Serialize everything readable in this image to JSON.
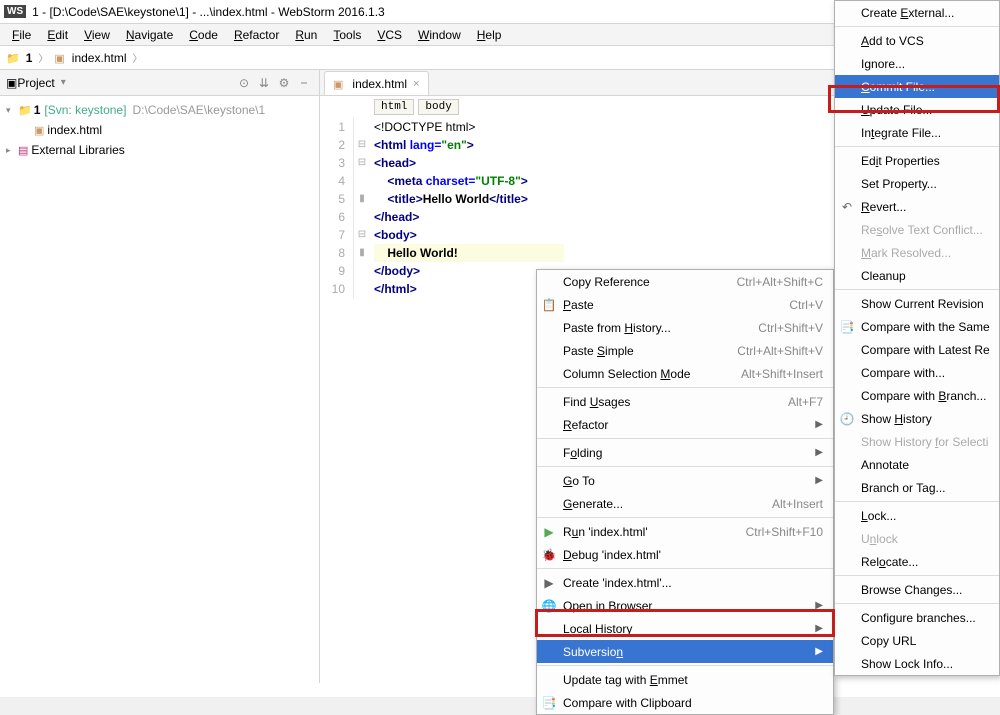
{
  "title": "1 - [D:\\Code\\SAE\\keystone\\1] - ...\\index.html - WebStorm 2016.1.3",
  "menubar": [
    "File",
    "Edit",
    "View",
    "Navigate",
    "Code",
    "Refactor",
    "Run",
    "Tools",
    "VCS",
    "Window",
    "Help"
  ],
  "nav": {
    "root": "1",
    "file": "index.html"
  },
  "sidebar": {
    "header": "Project",
    "root": "1",
    "vcs": "[Svn: keystone]",
    "path": "D:\\Code\\SAE\\keystone\\1",
    "file": "index.html",
    "ext": "External Libraries"
  },
  "editor": {
    "tab": "index.html",
    "crumbs": [
      "html",
      "body"
    ],
    "lines": [
      {
        "n": 1,
        "html": "&lt;!DOCTYPE html&gt;",
        "cls": "tok-tag"
      },
      {
        "n": 2,
        "html": "<span class='tok-ang'>&lt;</span><span class='tok-tag'>html</span> <span class='tok-attr'>lang=</span><span class='tok-str'>\"en\"</span><span class='tok-ang'>&gt;</span>"
      },
      {
        "n": 3,
        "html": "<span class='tok-ang'>&lt;</span><span class='tok-tag'>head</span><span class='tok-ang'>&gt;</span>"
      },
      {
        "n": 4,
        "html": "&nbsp;&nbsp;&nbsp;&nbsp;<span class='tok-ang'>&lt;</span><span class='tok-tag'>meta</span> <span class='tok-attr'>charset=</span><span class='tok-str'>\"UTF-8\"</span><span class='tok-ang'>&gt;</span>"
      },
      {
        "n": 5,
        "html": "&nbsp;&nbsp;&nbsp;&nbsp;<span class='tok-ang'>&lt;</span><span class='tok-tag'>title</span><span class='tok-ang'>&gt;</span><span class='tok-text'>Hello World</span><span class='tok-ang'>&lt;/</span><span class='tok-tag'>title</span><span class='tok-ang'>&gt;</span>"
      },
      {
        "n": 6,
        "html": "<span class='tok-ang'>&lt;/</span><span class='tok-tag'>head</span><span class='tok-ang'>&gt;</span>"
      },
      {
        "n": 7,
        "html": "<span class='tok-ang'>&lt;</span><span class='tok-tag'>body</span><span class='tok-ang'>&gt;</span>"
      },
      {
        "n": 8,
        "html": "<span class='hl'>&nbsp;&nbsp;&nbsp;&nbsp;<span class='tok-text'>Hello World!</span></span>"
      },
      {
        "n": 9,
        "html": "<span class='tok-ang'>&lt;/</span><span class='tok-tag'>body</span><span class='tok-ang'>&gt;</span>"
      },
      {
        "n": 10,
        "html": "<span class='tok-ang'>&lt;/</span><span class='tok-tag'>html</span><span class='tok-ang'>&gt;</span>"
      }
    ],
    "marks": {
      "2": "⊟",
      "3": "⊟",
      "5": "▮",
      "7": "⊟",
      "8": "▮"
    }
  },
  "ctx1": [
    {
      "t": "item",
      "label": "Copy Reference",
      "sc": "Ctrl+Alt+Shift+C"
    },
    {
      "t": "item",
      "label": "<u>P</u>aste",
      "sc": "Ctrl+V",
      "ic": "📋"
    },
    {
      "t": "item",
      "label": "Paste from <u>H</u>istory...",
      "sc": "Ctrl+Shift+V"
    },
    {
      "t": "item",
      "label": "Paste <u>S</u>imple",
      "sc": "Ctrl+Alt+Shift+V"
    },
    {
      "t": "item",
      "label": "Column Selection <u>M</u>ode",
      "sc": "Alt+Shift+Insert"
    },
    {
      "t": "sep"
    },
    {
      "t": "item",
      "label": "Find <u>U</u>sages",
      "sc": "Alt+F7"
    },
    {
      "t": "item",
      "label": "<u>R</u>efactor",
      "sub": true
    },
    {
      "t": "sep"
    },
    {
      "t": "item",
      "label": "F<u>o</u>lding",
      "sub": true
    },
    {
      "t": "sep"
    },
    {
      "t": "item",
      "label": "<u>G</u>o To",
      "sub": true
    },
    {
      "t": "item",
      "label": "<u>G</u>enerate...",
      "sc": "Alt+Insert"
    },
    {
      "t": "sep"
    },
    {
      "t": "item",
      "label": "R<u>u</u>n 'index.html'",
      "sc": "Ctrl+Shift+F10",
      "ic": "▶",
      "icc": "#5a5"
    },
    {
      "t": "item",
      "label": "<u>D</u>ebug 'index.html'",
      "ic": "🐞"
    },
    {
      "t": "sep"
    },
    {
      "t": "item",
      "label": "Create 'index.html'...",
      "ic": "▶"
    },
    {
      "t": "item",
      "label": "<u>O</u>pen in Browser",
      "sub": true,
      "ic": "🌐"
    },
    {
      "t": "item",
      "label": "<u>L</u>ocal History",
      "sub": true
    },
    {
      "t": "item",
      "label": "Subversio<u>n</u>",
      "sub": true,
      "sel": true
    },
    {
      "t": "sep"
    },
    {
      "t": "item",
      "label": "Update tag with <u>E</u>mmet"
    },
    {
      "t": "item",
      "label": "Compare with Clipboard",
      "ic": "📑"
    }
  ],
  "ctx2": [
    {
      "t": "item",
      "label": "Create <u>E</u>xternal..."
    },
    {
      "t": "sep"
    },
    {
      "t": "item",
      "label": "<u>A</u>dd to VCS"
    },
    {
      "t": "item",
      "label": "I<u>g</u>nore..."
    },
    {
      "t": "item",
      "label": "<u>C</u>ommit File...",
      "sel": true
    },
    {
      "t": "item",
      "label": "<u>U</u>pdate File..."
    },
    {
      "t": "item",
      "label": "In<u>t</u>egrate File..."
    },
    {
      "t": "sep"
    },
    {
      "t": "item",
      "label": "Ed<u>i</u>t Properties"
    },
    {
      "t": "item",
      "label": "Set Property..."
    },
    {
      "t": "item",
      "label": "<u>R</u>evert...",
      "ic": "↶"
    },
    {
      "t": "item",
      "label": "Re<u>s</u>olve Text Conflict...",
      "dis": true
    },
    {
      "t": "item",
      "label": "<u>M</u>ark Resolved...",
      "dis": true
    },
    {
      "t": "item",
      "label": "Cleanup"
    },
    {
      "t": "sep"
    },
    {
      "t": "item",
      "label": "Show Current Revision"
    },
    {
      "t": "item",
      "label": "Compare with the Same",
      "ic": "📑"
    },
    {
      "t": "item",
      "label": "Compare with Latest Re"
    },
    {
      "t": "item",
      "label": "Compare with..."
    },
    {
      "t": "item",
      "label": "Compare with <u>B</u>ranch..."
    },
    {
      "t": "item",
      "label": "Show <u>H</u>istory",
      "ic": "🕘"
    },
    {
      "t": "item",
      "label": "Show History <u>f</u>or Selecti",
      "dis": true
    },
    {
      "t": "item",
      "label": "Annotate"
    },
    {
      "t": "item",
      "label": "Branch or Tag..."
    },
    {
      "t": "sep"
    },
    {
      "t": "item",
      "label": "<u>L</u>ock..."
    },
    {
      "t": "item",
      "label": "U<u>n</u>lock",
      "dis": true
    },
    {
      "t": "item",
      "label": "Rel<u>o</u>cate..."
    },
    {
      "t": "sep"
    },
    {
      "t": "item",
      "label": "Browse Changes..."
    },
    {
      "t": "sep"
    },
    {
      "t": "item",
      "label": "Configure branches..."
    },
    {
      "t": "item",
      "label": "Copy URL"
    },
    {
      "t": "item",
      "label": "Show Lock Info..."
    }
  ]
}
